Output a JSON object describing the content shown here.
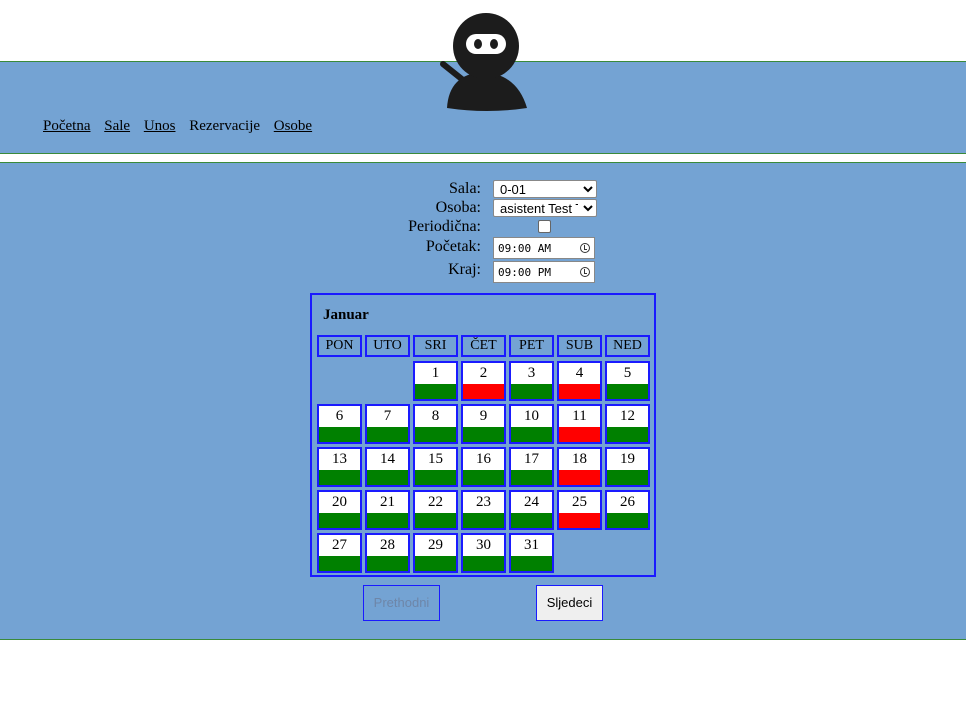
{
  "nav": {
    "items": [
      {
        "label": "Početna",
        "link": true
      },
      {
        "label": "Sale",
        "link": true
      },
      {
        "label": "Unos",
        "link": true
      },
      {
        "label": "Rezervacije",
        "link": false
      },
      {
        "label": "Osobe",
        "link": true
      }
    ]
  },
  "logo": {
    "icon": "ninja-logo-icon"
  },
  "form": {
    "sala_label": "Sala:",
    "sala_value": "0-01",
    "osoba_label": "Osoba:",
    "osoba_value": "asistent Test Te",
    "periodicna_label": "Periodična:",
    "periodicna_checked": false,
    "pocetak_label": "Početak:",
    "pocetak_value": "09:00 AM",
    "kraj_label": "Kraj:",
    "kraj_value": "09:00 PM"
  },
  "calendar": {
    "month": "Januar",
    "weekdays": [
      "PON",
      "UTO",
      "SRI",
      "ČET",
      "PET",
      "SUB",
      "NED"
    ],
    "first_weekday_index": 2,
    "days": [
      {
        "day": "1",
        "status": "free"
      },
      {
        "day": "2",
        "status": "busy"
      },
      {
        "day": "3",
        "status": "free"
      },
      {
        "day": "4",
        "status": "busy"
      },
      {
        "day": "5",
        "status": "free"
      },
      {
        "day": "6",
        "status": "free"
      },
      {
        "day": "7",
        "status": "free"
      },
      {
        "day": "8",
        "status": "free"
      },
      {
        "day": "9",
        "status": "free"
      },
      {
        "day": "10",
        "status": "free"
      },
      {
        "day": "11",
        "status": "busy"
      },
      {
        "day": "12",
        "status": "free"
      },
      {
        "day": "13",
        "status": "free"
      },
      {
        "day": "14",
        "status": "free"
      },
      {
        "day": "15",
        "status": "free"
      },
      {
        "day": "16",
        "status": "free"
      },
      {
        "day": "17",
        "status": "free"
      },
      {
        "day": "18",
        "status": "busy"
      },
      {
        "day": "19",
        "status": "free"
      },
      {
        "day": "20",
        "status": "free"
      },
      {
        "day": "21",
        "status": "free"
      },
      {
        "day": "22",
        "status": "free"
      },
      {
        "day": "23",
        "status": "free"
      },
      {
        "day": "24",
        "status": "free"
      },
      {
        "day": "25",
        "status": "busy"
      },
      {
        "day": "26",
        "status": "free"
      },
      {
        "day": "27",
        "status": "free"
      },
      {
        "day": "28",
        "status": "free"
      },
      {
        "day": "29",
        "status": "free"
      },
      {
        "day": "30",
        "status": "free"
      },
      {
        "day": "31",
        "status": "free"
      }
    ]
  },
  "buttons": {
    "prev_label": "Prethodni",
    "next_label": "Sljedeci"
  },
  "colors": {
    "band": "#74a3d3",
    "border": "#1a1aff",
    "free": "#008000",
    "busy": "#ff0000"
  }
}
